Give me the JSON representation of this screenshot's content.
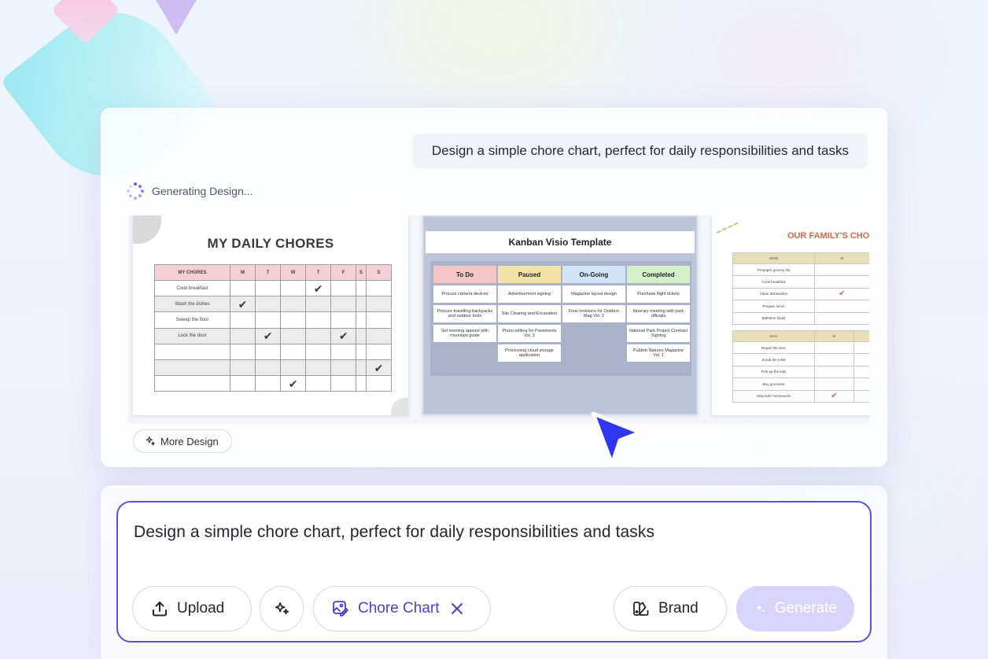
{
  "chat": {
    "user_prompt": "Design a simple chore chart, perfect for daily responsibilities and tasks",
    "status": "Generating Design...",
    "more_button": "More Design"
  },
  "designs": {
    "chores_card": {
      "title": "MY DAILY CHORES",
      "header": [
        "MY CHORES",
        "M",
        "T",
        "W",
        "T",
        "F",
        "S",
        "S"
      ],
      "rows": [
        {
          "name": "Cook breakfast",
          "checks": [
            0,
            0,
            0,
            1,
            0,
            0,
            0
          ]
        },
        {
          "name": "Wash the dishes",
          "checks": [
            1,
            0,
            0,
            0,
            0,
            0,
            0
          ]
        },
        {
          "name": "Sweep the floor",
          "checks": [
            0,
            0,
            0,
            0,
            0,
            0,
            0
          ]
        },
        {
          "name": "Lock the door",
          "checks": [
            0,
            1,
            0,
            0,
            1,
            0,
            0
          ]
        },
        {
          "name": "",
          "checks": [
            0,
            0,
            0,
            0,
            0,
            0,
            0
          ]
        },
        {
          "name": "",
          "checks": [
            0,
            0,
            0,
            0,
            0,
            0,
            1
          ]
        },
        {
          "name": "",
          "checks": [
            0,
            0,
            1,
            0,
            0,
            0,
            0
          ]
        }
      ]
    },
    "kanban_card": {
      "title": "Kanban Visio Template",
      "columns": [
        {
          "label": "To Do",
          "color": "#f5c6c6",
          "items": [
            "Procure camera devices",
            "Procure travelling backpacks and outdoor tools",
            "Set meeting appoint with mountain guide"
          ]
        },
        {
          "label": "Paused",
          "color": "#f4e1a8",
          "items": [
            "Advertisement signing",
            "Site Clearing and Excavation",
            "Photo editing for Pavements Vol. 3",
            "Processing cloud storage application"
          ]
        },
        {
          "label": "On-Going",
          "color": "#cfe5f7",
          "items": [
            "Magazine layout design",
            "Final revisions for Outdoor Mag Vol. 2"
          ]
        },
        {
          "label": "Completed",
          "color": "#d3f0c8",
          "items": [
            "Purchase flight tickets",
            "Itinerary meeting with park officials",
            "National Park Project Contract Signing",
            "Publish Natures Magazine Vol. 1"
          ]
        }
      ]
    },
    "family_card": {
      "title": "OUR FAMILY'S CHO",
      "table1": {
        "header": [
          "MOM",
          "M",
          "T",
          ""
        ],
        "rows": [
          {
            "name": "Prepapre grocery list",
            "checks": [
              0,
              0,
              0
            ]
          },
          {
            "name": "Cook breakfast",
            "checks": [
              0,
              0,
              0
            ]
          },
          {
            "name": "Clean dishwasher",
            "checks": [
              1,
              0,
              0
            ]
          },
          {
            "name": "Prepare lunch",
            "checks": [
              0,
              0,
              0
            ]
          },
          {
            "name": "Bathtime (kids)",
            "checks": [
              0,
              0,
              0
            ]
          }
        ]
      },
      "table2": {
        "header": [
          "DAD",
          "M",
          "T",
          ""
        ],
        "rows": [
          {
            "name": "Repair the door",
            "checks": [
              0,
              0,
              0
            ]
          },
          {
            "name": "Scrub the toilet",
            "checks": [
              0,
              1,
              0
            ]
          },
          {
            "name": "Pick-up the kids",
            "checks": [
              0,
              0,
              0
            ]
          },
          {
            "name": "Buy groceries",
            "checks": [
              0,
              0,
              0
            ]
          },
          {
            "name": "Help kids' homeworks",
            "checks": [
              1,
              0,
              0
            ]
          }
        ]
      }
    }
  },
  "composer": {
    "text": "Design a simple chore chart, perfect for daily responsibilities and tasks",
    "upload_label": "Upload",
    "chip_label": "Chore Chart",
    "brand_label": "Brand",
    "generate_label": "Generate",
    "accent": "#4a3fd0"
  }
}
